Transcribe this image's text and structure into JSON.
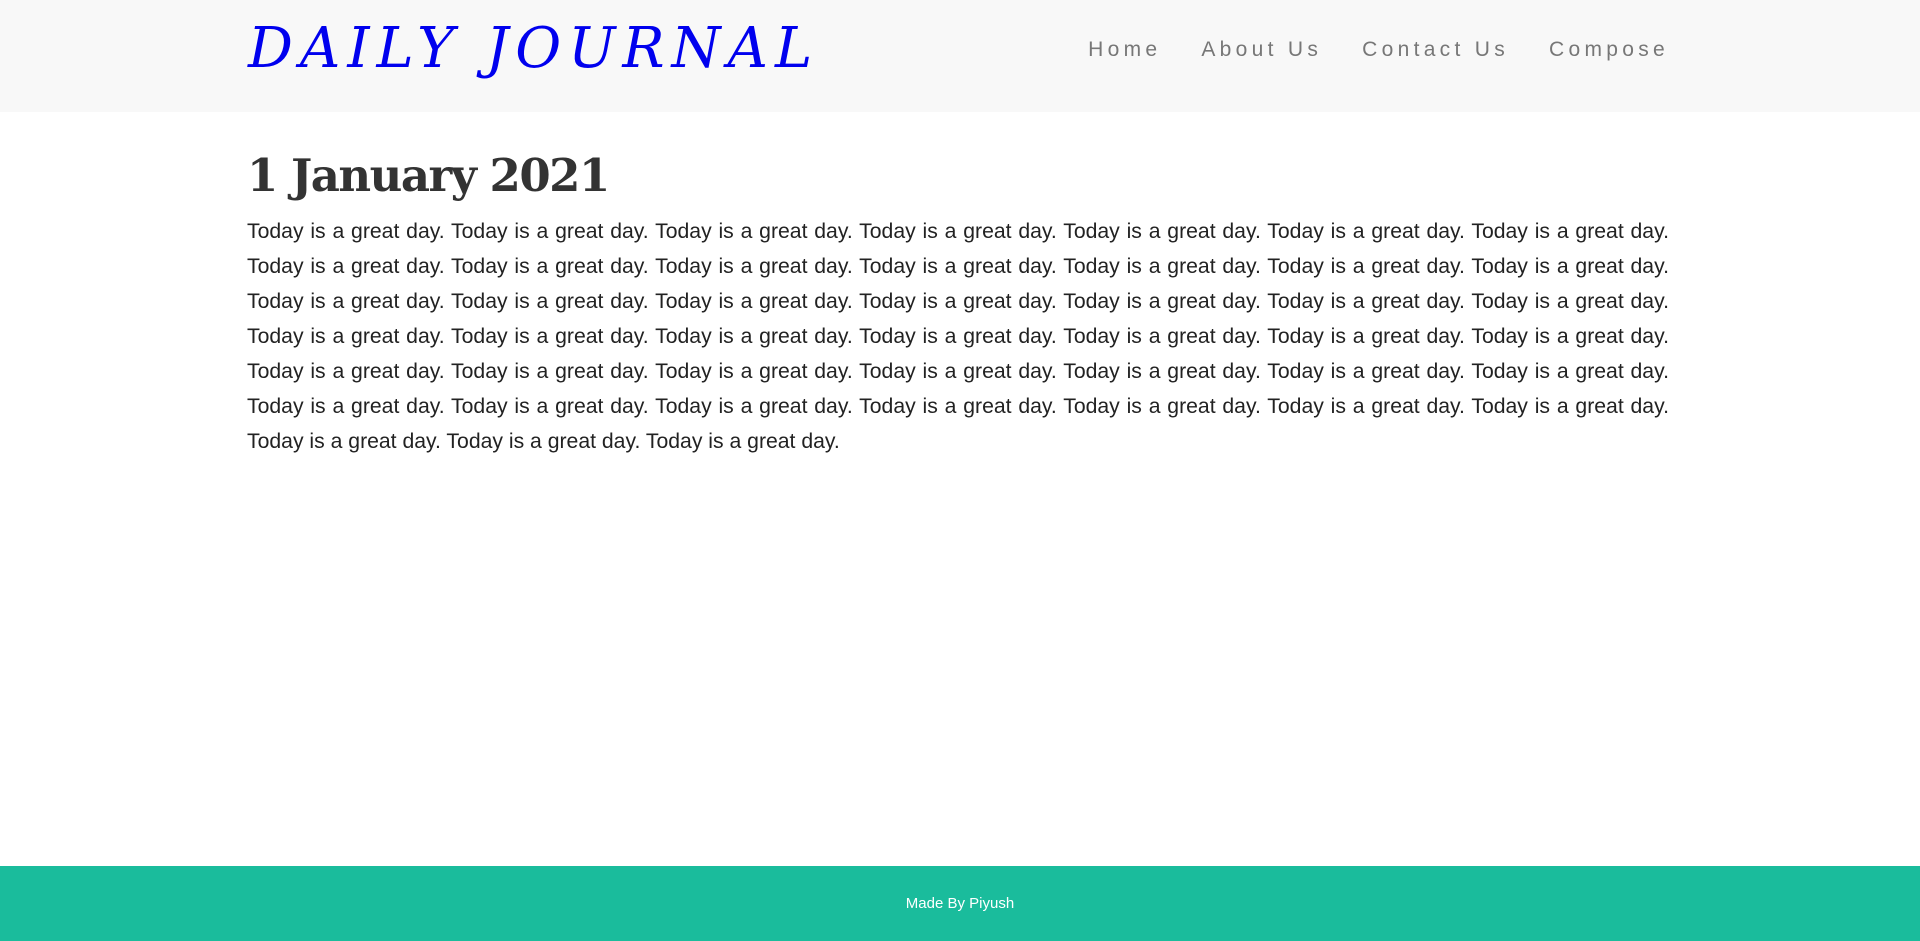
{
  "colors": {
    "brand": "#0000ee",
    "navbar_background": "#f8f8f8",
    "nav_link": "#777777",
    "title": "#333333",
    "body_text": "#222222",
    "footer_background": "#1abc9c",
    "footer_text": "#ffffff"
  },
  "header": {
    "brand": "DAILY JOURNAL",
    "nav": [
      {
        "label": "Home"
      },
      {
        "label": "About Us"
      },
      {
        "label": "Contact Us"
      },
      {
        "label": "Compose"
      }
    ]
  },
  "post": {
    "title": "1 January 2021",
    "body": "Today is a great day. Today is a great day. Today is a great day. Today is a great day. Today is a great day. Today is a great day. Today is a great day. Today is a great day. Today is a great day. Today is a great day. Today is a great day. Today is a great day. Today is a great day. Today is a great day. Today is a great day. Today is a great day. Today is a great day. Today is a great day. Today is a great day. Today is a great day. Today is a great day. Today is a great day. Today is a great day. Today is a great day. Today is a great day. Today is a great day. Today is a great day. Today is a great day. Today is a great day. Today is a great day. Today is a great day. Today is a great day. Today is a great day. Today is a great day. Today is a great day. Today is a great day. Today is a great day. Today is a great day. Today is a great day. Today is a great day. Today is a great day. Today is a great day. Today is a great day. Today is a great day. Today is a great day."
  },
  "footer": {
    "text": "Made By Piyush"
  }
}
